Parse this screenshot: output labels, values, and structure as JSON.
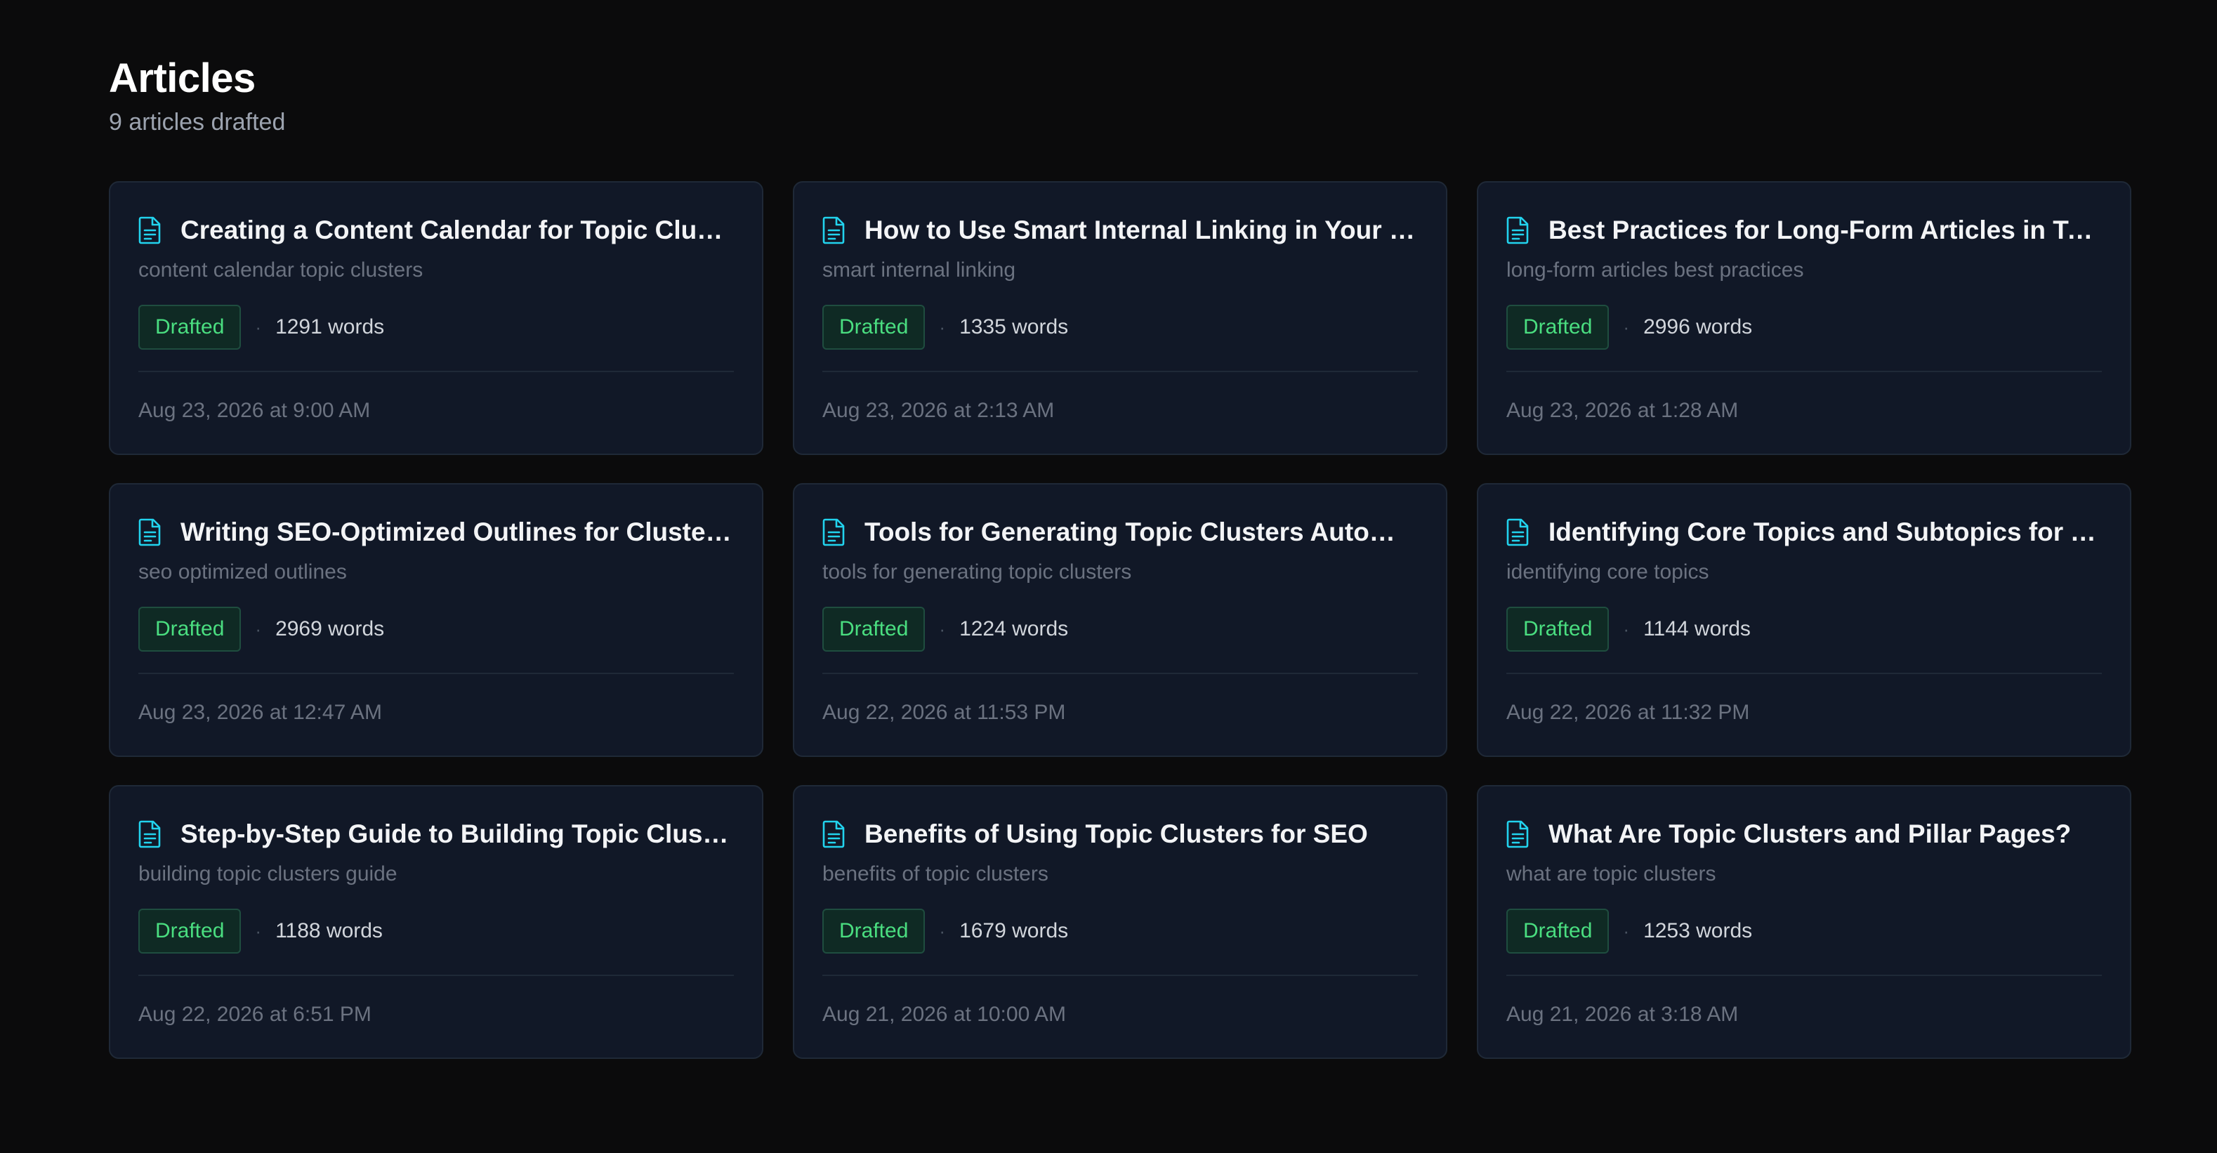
{
  "header": {
    "title": "Articles",
    "subtitle": "9 articles drafted"
  },
  "colors": {
    "background": "#0b0b0c",
    "card": "#111827",
    "accent_icon": "#22d3ee",
    "status_green": "#4ade80"
  },
  "articles": [
    {
      "title": "Creating a Content Calendar for Topic Clusters",
      "keyword": "content calendar topic clusters",
      "status": "Drafted",
      "words": "1291 words",
      "date": "Aug 23, 2026 at 9:00 AM",
      "icon": "document-icon"
    },
    {
      "title": "How to Use Smart Internal Linking in Your Cont...",
      "keyword": "smart internal linking",
      "status": "Drafted",
      "words": "1335 words",
      "date": "Aug 23, 2026 at 2:13 AM",
      "icon": "document-icon"
    },
    {
      "title": "Best Practices for Long-Form Articles in Topic Cl...",
      "keyword": "long-form articles best practices",
      "status": "Drafted",
      "words": "2996 words",
      "date": "Aug 23, 2026 at 1:28 AM",
      "icon": "document-icon"
    },
    {
      "title": "Writing SEO-Optimized Outlines for Cluster Arti...",
      "keyword": "seo optimized outlines",
      "status": "Drafted",
      "words": "2969 words",
      "date": "Aug 23, 2026 at 12:47 AM",
      "icon": "document-icon"
    },
    {
      "title": "Tools for Generating Topic Clusters Automatically",
      "keyword": "tools for generating topic clusters",
      "status": "Drafted",
      "words": "1224 words",
      "date": "Aug 22, 2026 at 11:53 PM",
      "icon": "document-icon"
    },
    {
      "title": "Identifying Core Topics and Subtopics for Your ...",
      "keyword": "identifying core topics",
      "status": "Drafted",
      "words": "1144 words",
      "date": "Aug 22, 2026 at 11:32 PM",
      "icon": "document-icon"
    },
    {
      "title": "Step-by-Step Guide to Building Topic Clusters",
      "keyword": "building topic clusters guide",
      "status": "Drafted",
      "words": "1188 words",
      "date": "Aug 22, 2026 at 6:51 PM",
      "icon": "document-icon"
    },
    {
      "title": "Benefits of Using Topic Clusters for SEO",
      "keyword": "benefits of topic clusters",
      "status": "Drafted",
      "words": "1679 words",
      "date": "Aug 21, 2026 at 10:00 AM",
      "icon": "document-icon"
    },
    {
      "title": "What Are Topic Clusters and Pillar Pages?",
      "keyword": "what are topic clusters",
      "status": "Drafted",
      "words": "1253 words",
      "date": "Aug 21, 2026 at 3:18 AM",
      "icon": "document-icon"
    }
  ]
}
